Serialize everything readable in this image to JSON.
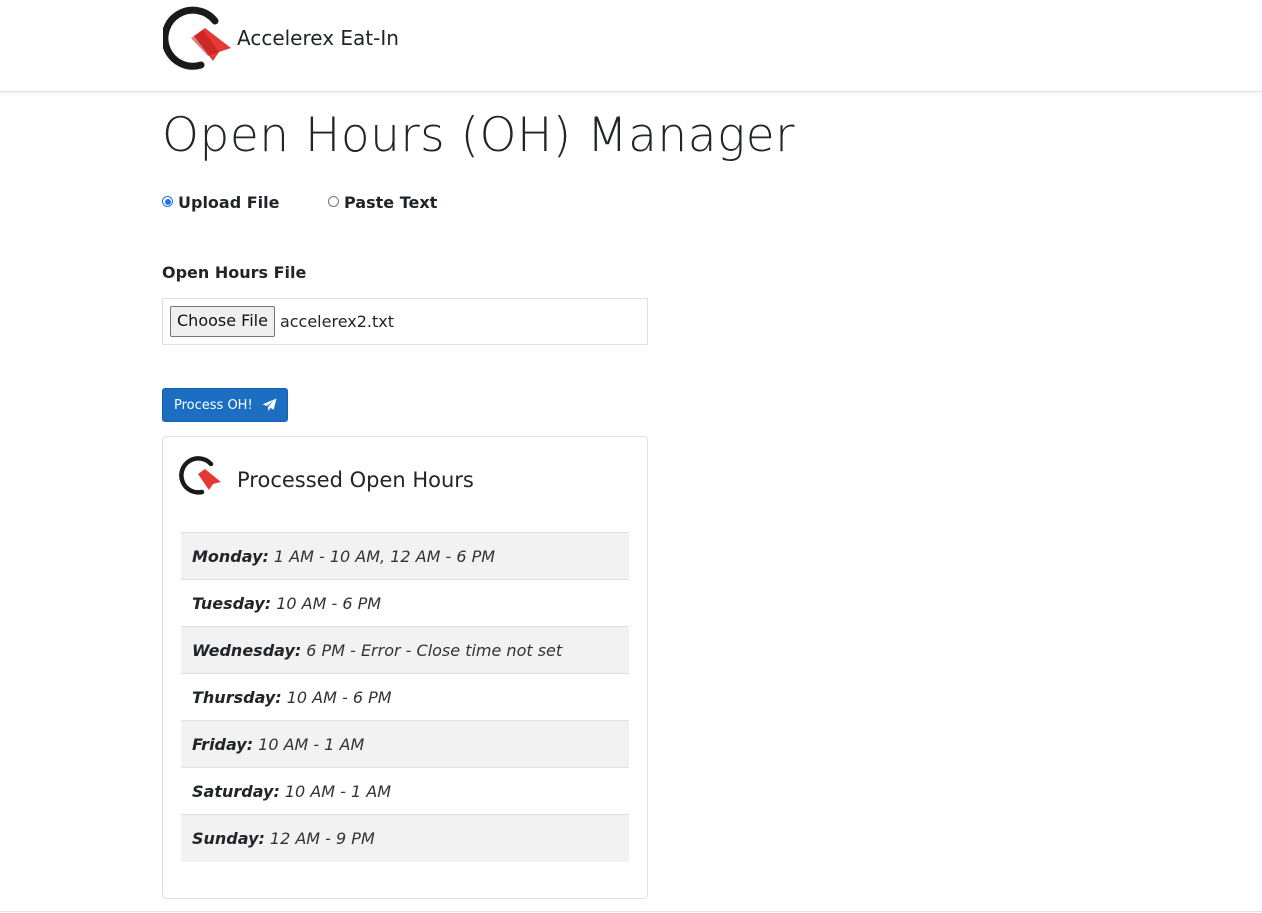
{
  "header": {
    "brand_name": "Accelerex Eat-In"
  },
  "page": {
    "title": "Open Hours (OH) Manager"
  },
  "input_mode": {
    "options": [
      {
        "label": "Upload File",
        "checked": true
      },
      {
        "label": "Paste Text",
        "checked": false
      }
    ]
  },
  "file_field": {
    "label": "Open Hours File",
    "button_label": "Choose File",
    "file_name": "accelerex2.txt"
  },
  "actions": {
    "process_label": "Process OH!",
    "process_icon": "paper-plane-icon"
  },
  "result": {
    "title": "Processed Open Hours",
    "rows": [
      {
        "day": "Monday:",
        "hours": "1 AM - 10 AM, 12 AM - 6 PM"
      },
      {
        "day": "Tuesday:",
        "hours": "10 AM - 6 PM"
      },
      {
        "day": "Wednesday:",
        "hours": "6 PM - Error - Close time not set"
      },
      {
        "day": "Thursday:",
        "hours": "10 AM - 6 PM"
      },
      {
        "day": "Friday:",
        "hours": "10 AM - 1 AM"
      },
      {
        "day": "Saturday:",
        "hours": "10 AM - 1 AM"
      },
      {
        "day": "Sunday:",
        "hours": "12 AM - 9 PM"
      }
    ]
  },
  "colors": {
    "primary_button": "#1b6ec2",
    "logo_dark": "#1a1a1a",
    "logo_red": "#e53935",
    "striped_row": "#f2f2f2"
  }
}
